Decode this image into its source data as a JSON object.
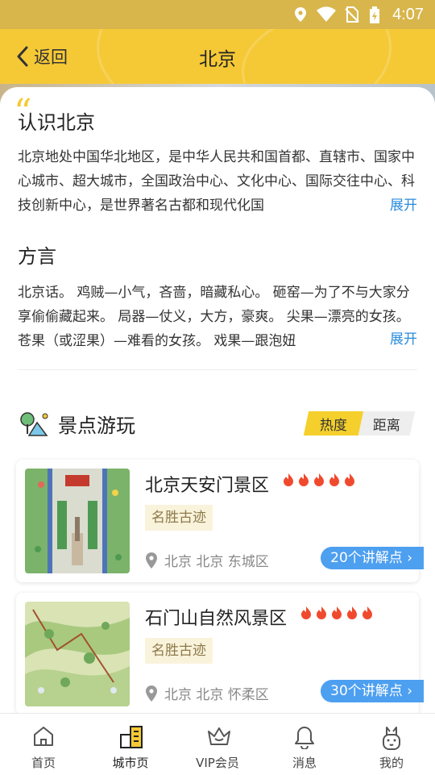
{
  "status_bar": {
    "time": "4:07"
  },
  "header": {
    "back_label": "返回",
    "title": "北京"
  },
  "about": {
    "title": "认识北京",
    "text": "北京地处中国华北地区，是中华人民共和国首都、直辖市、国家中心城市、超大城市，全国政治中心、文化中心、国际交往中心、科技创新中心，是世界著名古都和现代化国",
    "expand_label": "展开"
  },
  "dialect": {
    "title": "方言",
    "text": "北京话。 鸡贼—小气，吝啬，暗藏私心。 砸窑—为了不与大家分享偷偷藏起来。 局器—仗义，大方，豪爽。 尖果—漂亮的女孩。 苍果（或涩果）—难看的女孩。 戏果—跟泡妞",
    "expand_label": "展开"
  },
  "spots": {
    "title": "景点游玩",
    "sort_hot": "热度",
    "sort_distance": "距离",
    "items": [
      {
        "name": "北京天安门景区",
        "heat": 5,
        "tag": "名胜古迹",
        "location": "北京 北京 东城区",
        "points": "20个讲解点"
      },
      {
        "name": "石门山自然风景区",
        "heat": 5,
        "tag": "名胜古迹",
        "location": "北京 北京 怀柔区",
        "points": "30个讲解点"
      }
    ]
  },
  "tabbar": {
    "items": [
      {
        "label": "首页",
        "icon": "home-icon"
      },
      {
        "label": "城市页",
        "icon": "city-icon",
        "active": true
      },
      {
        "label": "VIP会员",
        "icon": "crown-icon"
      },
      {
        "label": "消息",
        "icon": "bell-icon"
      },
      {
        "label": "我的",
        "icon": "rabbit-icon"
      }
    ]
  },
  "colors": {
    "accent": "#f5c936",
    "link": "#2a8bdc",
    "points_badge": "#4d9ff0",
    "flame": "#f04a2e"
  }
}
